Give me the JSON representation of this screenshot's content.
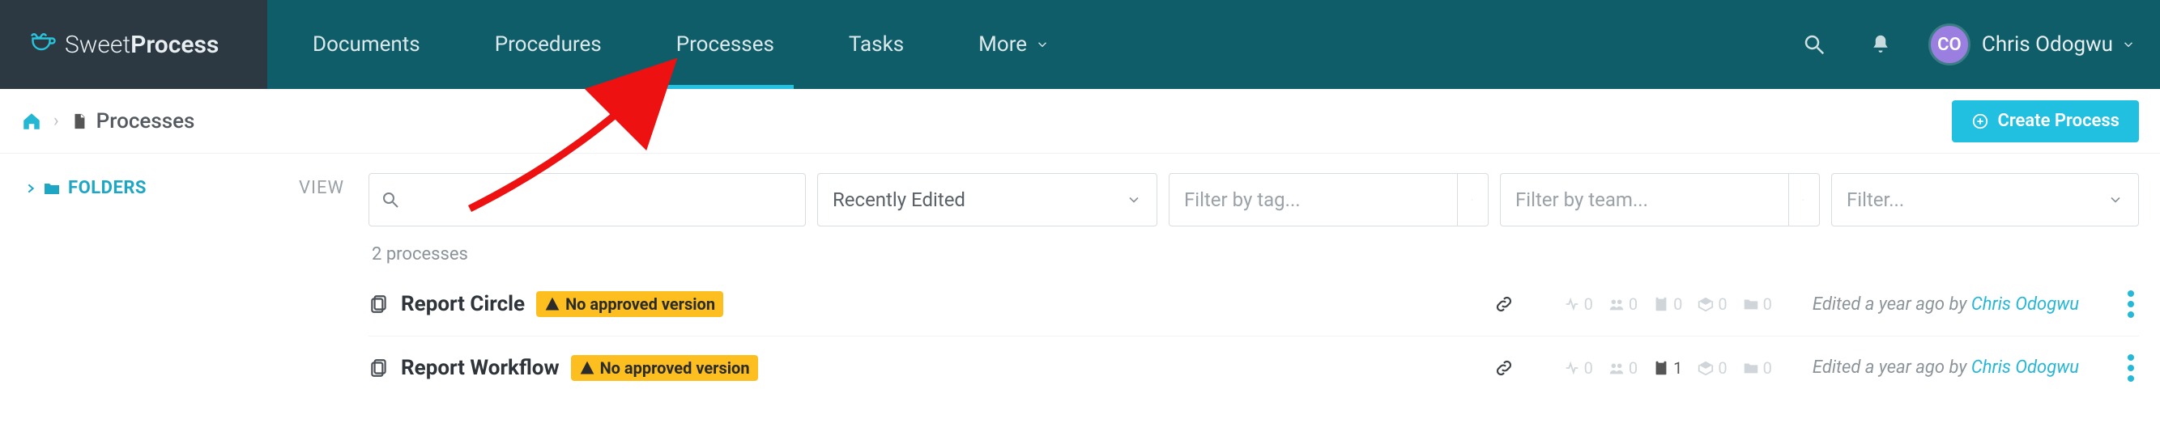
{
  "brand": {
    "thin": "Sweet",
    "bold": "Process"
  },
  "nav": {
    "items": [
      {
        "label": "Documents",
        "active": false
      },
      {
        "label": "Procedures",
        "active": false
      },
      {
        "label": "Processes",
        "active": true
      },
      {
        "label": "Tasks",
        "active": false
      },
      {
        "label": "More",
        "active": false,
        "caret": true
      }
    ]
  },
  "user": {
    "initials": "CO",
    "name": "Chris Odogwu"
  },
  "breadcrumb": {
    "page": "Processes"
  },
  "actions": {
    "create_label": "Create Process"
  },
  "sidebar": {
    "folders_label": "FOLDERS",
    "view_label": "VIEW"
  },
  "filters": {
    "search_placeholder": "",
    "sort_value": "Recently Edited",
    "tag_placeholder": "Filter by tag...",
    "team_placeholder": "Filter by team...",
    "generic_placeholder": "Filter..."
  },
  "list": {
    "count_label": "2 processes",
    "edited_prefix": "Edited a year ago by ",
    "editor": "Chris Odogwu",
    "badge_label": "No approved version",
    "rows": [
      {
        "title": "Report Circle",
        "stats": [
          "0",
          "0",
          "0",
          "0",
          "0"
        ],
        "highlight_index": -1
      },
      {
        "title": "Report Workflow",
        "stats": [
          "0",
          "0",
          "1",
          "0",
          "0"
        ],
        "highlight_index": 2
      }
    ]
  },
  "colors": {
    "accent": "#21bfe0",
    "nav_bg": "#0f5d68",
    "logo_bg": "#2d3942",
    "badge": "#fcbf1f"
  }
}
